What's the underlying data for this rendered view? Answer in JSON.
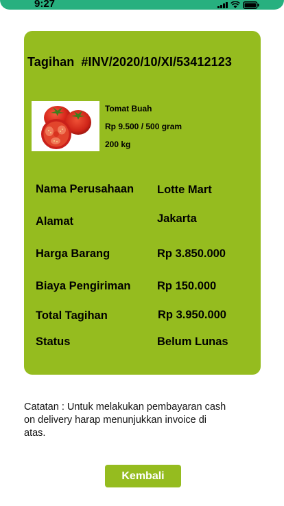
{
  "status_bar": {
    "time": "9:27",
    "icons": [
      "signal-icon",
      "wifi-icon",
      "battery-icon"
    ],
    "color": "#27b07f"
  },
  "invoice": {
    "label": "Tagihan",
    "number": "#INV/2020/10/XI/53412123",
    "card_color": "#95bc1f"
  },
  "product": {
    "image": "tomato-image",
    "name": "Tomat Buah",
    "price": "Rp 9.500 / 500 gram",
    "quantity": "200 kg"
  },
  "details": {
    "company_label": "Nama Perusahaan",
    "company_value": "Lotte Mart",
    "address_label": "Alamat",
    "address_value": "Jakarta",
    "price_label": "Harga Barang",
    "price_value": "Rp 3.850.000",
    "shipping_label": "Biaya Pengiriman",
    "shipping_value": "Rp 150.000",
    "total_label": "Total Tagihan",
    "total_value": "Rp 3.950.000",
    "status_label": "Status",
    "status_value": "Belum Lunas"
  },
  "note": "Catatan : Untuk melakukan pembayaran cash on delivery harap menunjukkan invoice di atas.",
  "back_button": {
    "label": "Kembali",
    "color": "#95bc1f"
  }
}
